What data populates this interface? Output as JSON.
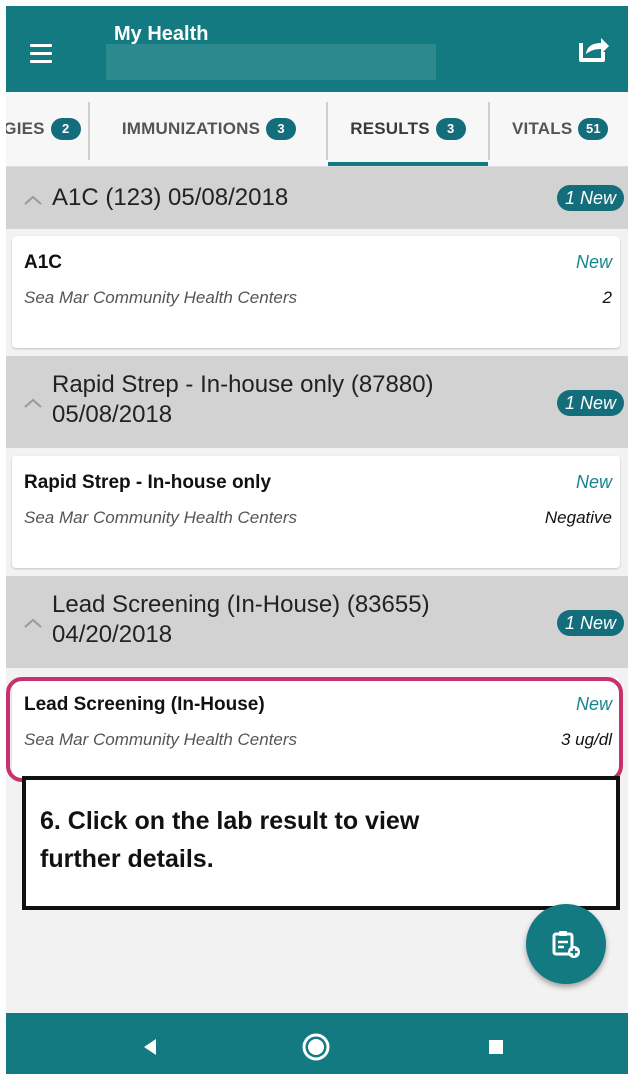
{
  "app_bar": {
    "title": "My Health",
    "menu_icon": "hamburger-menu-icon",
    "share_icon": "share-icon"
  },
  "tabs": [
    {
      "label": "GIES",
      "count": "2"
    },
    {
      "label": "IMMUNIZATIONS",
      "count": "3"
    },
    {
      "label": "RESULTS",
      "count": "3",
      "active": true
    },
    {
      "label": "VITALS",
      "count": "51"
    }
  ],
  "groups": [
    {
      "title_line1": "A1C (123) 05/08/2018",
      "title_line2": "",
      "badge": "1 New",
      "result": {
        "title": "A1C",
        "org": "Sea Mar Community Health Centers",
        "status": "New",
        "value": "2"
      }
    },
    {
      "title_line1": "Rapid Strep - In-house only (87880)",
      "title_line2": "05/08/2018",
      "badge": "1 New",
      "result": {
        "title": "Rapid Strep - In-house only",
        "org": "Sea Mar Community Health Centers",
        "status": "New",
        "value": "Negative"
      }
    },
    {
      "title_line1": "Lead Screening (In-House) (83655)",
      "title_line2": "04/20/2018",
      "badge": "1 New",
      "result": {
        "title": "Lead Screening (In-House)",
        "org": "Sea Mar Community Health Centers",
        "status": "New",
        "value": "3 ug/dl"
      }
    }
  ],
  "instruction": {
    "line1": "6.  Click on the lab result to view",
    "line2": "further details."
  },
  "fab_icon": "add-record-icon",
  "colors": {
    "primary": "#127a80",
    "badge": "#136d7a",
    "highlight": "#c7326d",
    "group_header": "#d2d2d2"
  },
  "nav_icons": [
    "back-triangle-icon",
    "home-circle-icon",
    "recents-square-icon"
  ]
}
